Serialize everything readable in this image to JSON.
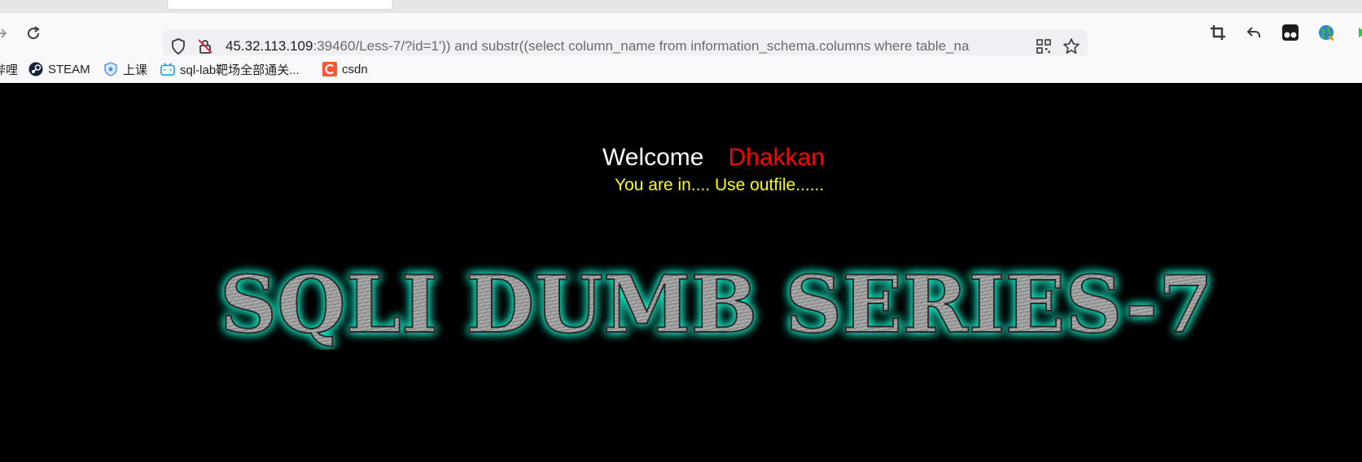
{
  "browser": {
    "url_host": "45.32.113.109",
    "url_rest": ":39460/Less-7/?id=1')) and substr((select column_name from information_schema.columns where table_na",
    "bookmarks": [
      {
        "label": "哔哩",
        "icon": "bilibili-icon"
      },
      {
        "label": "STEAM",
        "icon": "steam-icon"
      },
      {
        "label": "上课",
        "icon": "shield-badge-icon"
      },
      {
        "label": "sql-lab靶场全部通关...",
        "icon": "bilibili-tv-icon"
      },
      {
        "label": "csdn",
        "icon": "csdn-icon"
      }
    ],
    "accent": "#0a84ff"
  },
  "page": {
    "welcome_label": "Welcome",
    "welcome_name": "Dhakkan",
    "message": "You are in.... Use outfile......",
    "banner_text": "SQLI DUMB SERIES-7",
    "colors": {
      "welcome": "#ffffff",
      "name": "#ff0000",
      "message": "#ffff00",
      "banner_glow": "#19e6c2"
    }
  }
}
